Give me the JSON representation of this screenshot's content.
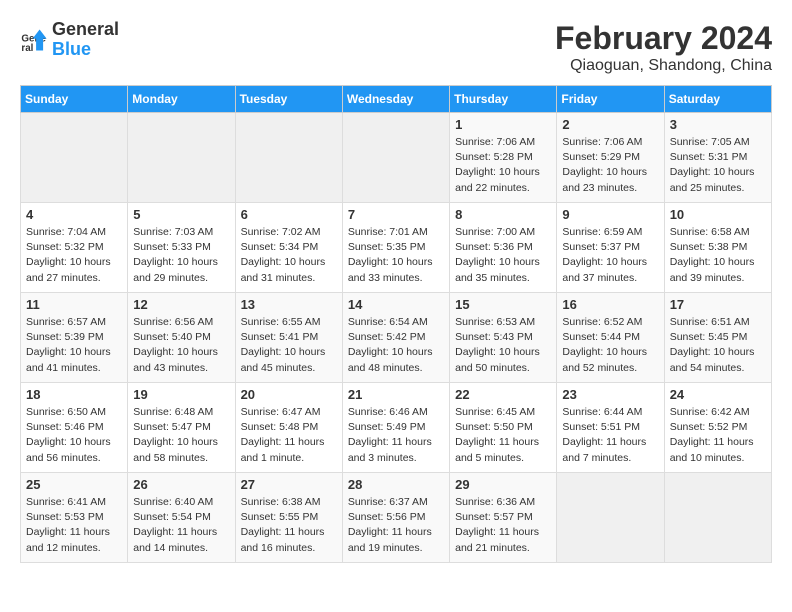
{
  "logo": {
    "line1": "General",
    "line2": "Blue"
  },
  "title": "February 2024",
  "subtitle": "Qiaoguan, Shandong, China",
  "header_days": [
    "Sunday",
    "Monday",
    "Tuesday",
    "Wednesday",
    "Thursday",
    "Friday",
    "Saturday"
  ],
  "weeks": [
    [
      {
        "day": "",
        "info": ""
      },
      {
        "day": "",
        "info": ""
      },
      {
        "day": "",
        "info": ""
      },
      {
        "day": "",
        "info": ""
      },
      {
        "day": "1",
        "info": "Sunrise: 7:06 AM\nSunset: 5:28 PM\nDaylight: 10 hours\nand 22 minutes."
      },
      {
        "day": "2",
        "info": "Sunrise: 7:06 AM\nSunset: 5:29 PM\nDaylight: 10 hours\nand 23 minutes."
      },
      {
        "day": "3",
        "info": "Sunrise: 7:05 AM\nSunset: 5:31 PM\nDaylight: 10 hours\nand 25 minutes."
      }
    ],
    [
      {
        "day": "4",
        "info": "Sunrise: 7:04 AM\nSunset: 5:32 PM\nDaylight: 10 hours\nand 27 minutes."
      },
      {
        "day": "5",
        "info": "Sunrise: 7:03 AM\nSunset: 5:33 PM\nDaylight: 10 hours\nand 29 minutes."
      },
      {
        "day": "6",
        "info": "Sunrise: 7:02 AM\nSunset: 5:34 PM\nDaylight: 10 hours\nand 31 minutes."
      },
      {
        "day": "7",
        "info": "Sunrise: 7:01 AM\nSunset: 5:35 PM\nDaylight: 10 hours\nand 33 minutes."
      },
      {
        "day": "8",
        "info": "Sunrise: 7:00 AM\nSunset: 5:36 PM\nDaylight: 10 hours\nand 35 minutes."
      },
      {
        "day": "9",
        "info": "Sunrise: 6:59 AM\nSunset: 5:37 PM\nDaylight: 10 hours\nand 37 minutes."
      },
      {
        "day": "10",
        "info": "Sunrise: 6:58 AM\nSunset: 5:38 PM\nDaylight: 10 hours\nand 39 minutes."
      }
    ],
    [
      {
        "day": "11",
        "info": "Sunrise: 6:57 AM\nSunset: 5:39 PM\nDaylight: 10 hours\nand 41 minutes."
      },
      {
        "day": "12",
        "info": "Sunrise: 6:56 AM\nSunset: 5:40 PM\nDaylight: 10 hours\nand 43 minutes."
      },
      {
        "day": "13",
        "info": "Sunrise: 6:55 AM\nSunset: 5:41 PM\nDaylight: 10 hours\nand 45 minutes."
      },
      {
        "day": "14",
        "info": "Sunrise: 6:54 AM\nSunset: 5:42 PM\nDaylight: 10 hours\nand 48 minutes."
      },
      {
        "day": "15",
        "info": "Sunrise: 6:53 AM\nSunset: 5:43 PM\nDaylight: 10 hours\nand 50 minutes."
      },
      {
        "day": "16",
        "info": "Sunrise: 6:52 AM\nSunset: 5:44 PM\nDaylight: 10 hours\nand 52 minutes."
      },
      {
        "day": "17",
        "info": "Sunrise: 6:51 AM\nSunset: 5:45 PM\nDaylight: 10 hours\nand 54 minutes."
      }
    ],
    [
      {
        "day": "18",
        "info": "Sunrise: 6:50 AM\nSunset: 5:46 PM\nDaylight: 10 hours\nand 56 minutes."
      },
      {
        "day": "19",
        "info": "Sunrise: 6:48 AM\nSunset: 5:47 PM\nDaylight: 10 hours\nand 58 minutes."
      },
      {
        "day": "20",
        "info": "Sunrise: 6:47 AM\nSunset: 5:48 PM\nDaylight: 11 hours\nand 1 minute."
      },
      {
        "day": "21",
        "info": "Sunrise: 6:46 AM\nSunset: 5:49 PM\nDaylight: 11 hours\nand 3 minutes."
      },
      {
        "day": "22",
        "info": "Sunrise: 6:45 AM\nSunset: 5:50 PM\nDaylight: 11 hours\nand 5 minutes."
      },
      {
        "day": "23",
        "info": "Sunrise: 6:44 AM\nSunset: 5:51 PM\nDaylight: 11 hours\nand 7 minutes."
      },
      {
        "day": "24",
        "info": "Sunrise: 6:42 AM\nSunset: 5:52 PM\nDaylight: 11 hours\nand 10 minutes."
      }
    ],
    [
      {
        "day": "25",
        "info": "Sunrise: 6:41 AM\nSunset: 5:53 PM\nDaylight: 11 hours\nand 12 minutes."
      },
      {
        "day": "26",
        "info": "Sunrise: 6:40 AM\nSunset: 5:54 PM\nDaylight: 11 hours\nand 14 minutes."
      },
      {
        "day": "27",
        "info": "Sunrise: 6:38 AM\nSunset: 5:55 PM\nDaylight: 11 hours\nand 16 minutes."
      },
      {
        "day": "28",
        "info": "Sunrise: 6:37 AM\nSunset: 5:56 PM\nDaylight: 11 hours\nand 19 minutes."
      },
      {
        "day": "29",
        "info": "Sunrise: 6:36 AM\nSunset: 5:57 PM\nDaylight: 11 hours\nand 21 minutes."
      },
      {
        "day": "",
        "info": ""
      },
      {
        "day": "",
        "info": ""
      }
    ]
  ]
}
